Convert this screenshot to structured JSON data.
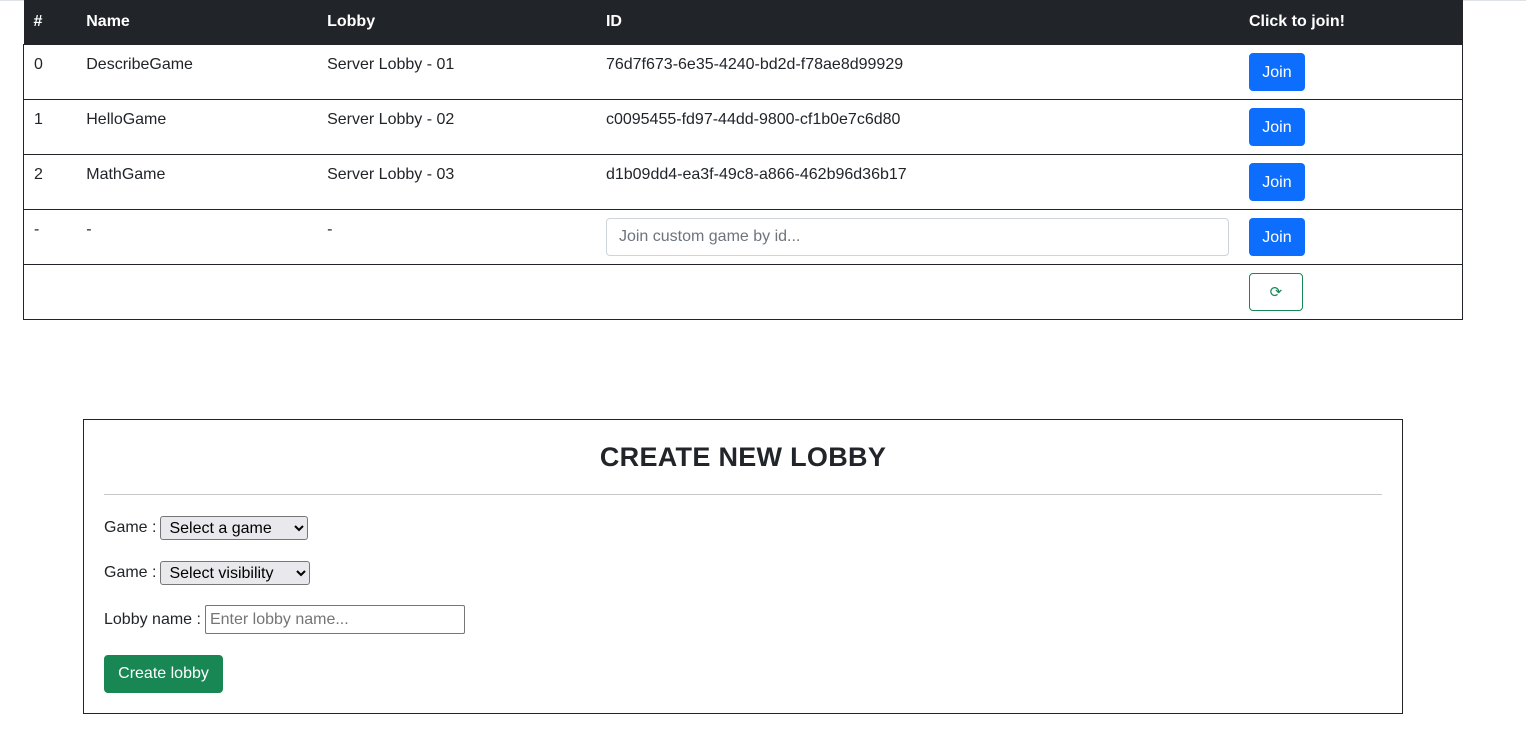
{
  "table": {
    "headers": [
      "#",
      "Name",
      "Lobby",
      "ID",
      "Click to join!"
    ],
    "rows": [
      {
        "index": "0",
        "name": "DescribeGame",
        "lobby": "Server Lobby - 01",
        "id": "76d7f673-6e35-4240-bd2d-f78ae8d99929",
        "join_label": "Join"
      },
      {
        "index": "1",
        "name": "HelloGame",
        "lobby": "Server Lobby - 02",
        "id": "c0095455-fd97-44dd-9800-cf1b0e7c6d80",
        "join_label": "Join"
      },
      {
        "index": "2",
        "name": "MathGame",
        "lobby": "Server Lobby - 03",
        "id": "d1b09dd4-ea3f-49c8-a866-462b96d36b17",
        "join_label": "Join"
      }
    ],
    "custom_row": {
      "index": "-",
      "name": "-",
      "lobby": "-",
      "id_placeholder": "Join custom game by id...",
      "join_label": "Join"
    },
    "refresh_label": "⟳"
  },
  "create": {
    "title": "CREATE NEW LOBBY",
    "game_label": "Game :",
    "game_select_value": "Select a game",
    "visibility_label": "Game :",
    "visibility_select_value": "Select visibility",
    "lobby_name_label": "Lobby name :",
    "lobby_name_placeholder": "Enter lobby name...",
    "create_button_label": "Create lobby"
  },
  "colors": {
    "header_bg": "#212529",
    "primary": "#0d6efd",
    "success": "#198754"
  }
}
